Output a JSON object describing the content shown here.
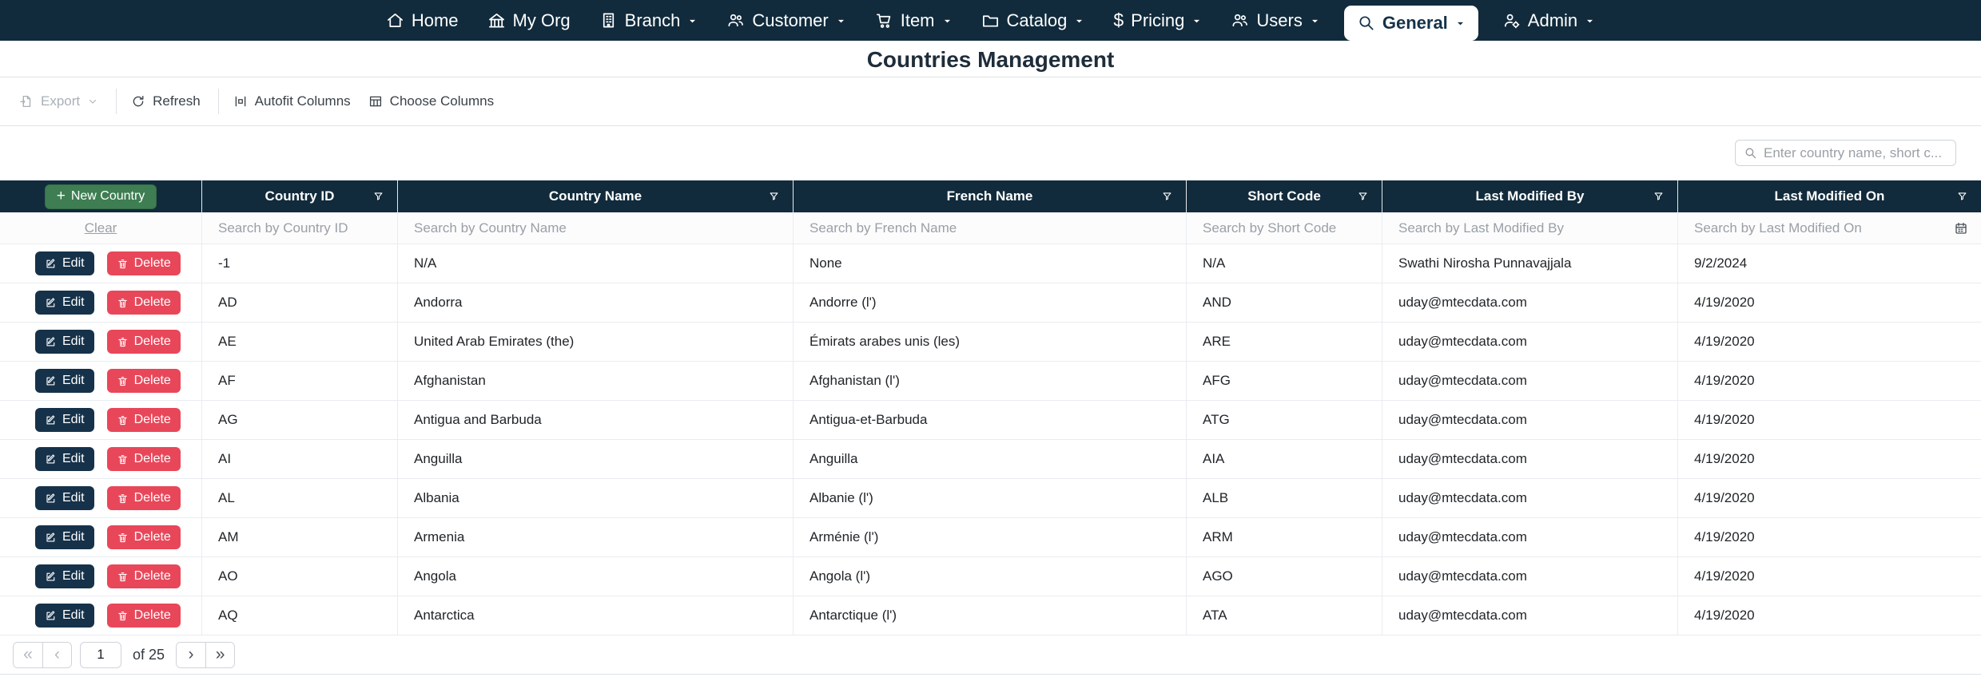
{
  "navbar": {
    "items": [
      {
        "label": "Home",
        "icon": "home-icon",
        "caret": false,
        "active": false
      },
      {
        "label": "My Org",
        "icon": "bank-icon",
        "caret": false,
        "active": false
      },
      {
        "label": "Branch",
        "icon": "building-icon",
        "caret": true,
        "active": false
      },
      {
        "label": "Customer",
        "icon": "people-icon",
        "caret": true,
        "active": false
      },
      {
        "label": "Item",
        "icon": "cart-icon",
        "caret": true,
        "active": false
      },
      {
        "label": "Catalog",
        "icon": "folder-icon",
        "caret": true,
        "active": false
      },
      {
        "label": "Pricing",
        "icon": "dollar-icon",
        "caret": true,
        "active": false
      },
      {
        "label": "Users",
        "icon": "people-icon",
        "caret": true,
        "active": false
      },
      {
        "label": "General",
        "icon": "search-icon",
        "caret": true,
        "active": true
      },
      {
        "label": "Admin",
        "icon": "person-gear-icon",
        "caret": true,
        "active": false
      }
    ]
  },
  "page": {
    "title": "Countries Management"
  },
  "toolbar": {
    "items": [
      {
        "label": "Export",
        "icon": "export-icon",
        "caret": true,
        "disabled": true,
        "divider_after": true
      },
      {
        "label": "Refresh",
        "icon": "refresh-icon",
        "caret": false,
        "disabled": false,
        "divider_after": true
      },
      {
        "label": "Autofit Columns",
        "icon": "autofit-icon",
        "caret": false,
        "disabled": false,
        "divider_after": false
      },
      {
        "label": "Choose Columns",
        "icon": "table-icon",
        "caret": false,
        "disabled": false,
        "divider_after": false
      }
    ]
  },
  "search": {
    "placeholder": "Enter country name, short c..."
  },
  "grid": {
    "columns": [
      {
        "label": "Country ID"
      },
      {
        "label": "Country Name"
      },
      {
        "label": "French Name"
      },
      {
        "label": "Short Code"
      },
      {
        "label": "Last Modified By"
      },
      {
        "label": "Last Modified On"
      }
    ],
    "filters": {
      "clear_label": "Clear",
      "placeholders": [
        "Search by Country ID",
        "Search by Country Name",
        "Search by French Name",
        "Search by Short Code",
        "Search by Last Modified By",
        "Search by Last Modified On"
      ],
      "calendar_on_last": true
    },
    "actions": {
      "new_label": "New Country",
      "edit_label": "Edit",
      "delete_label": "Delete"
    },
    "rows": [
      [
        "-1",
        "N/A",
        "None",
        "N/A",
        "Swathi Nirosha Punnavajjala",
        "9/2/2024"
      ],
      [
        "AD",
        "Andorra",
        "Andorre (l')",
        "AND",
        "uday@mtecdata.com",
        "4/19/2020"
      ],
      [
        "AE",
        "United Arab Emirates (the)",
        "Émirats arabes unis (les)",
        "ARE",
        "uday@mtecdata.com",
        "4/19/2020"
      ],
      [
        "AF",
        "Afghanistan",
        "Afghanistan (l')",
        "AFG",
        "uday@mtecdata.com",
        "4/19/2020"
      ],
      [
        "AG",
        "Antigua and Barbuda",
        "Antigua-et-Barbuda",
        "ATG",
        "uday@mtecdata.com",
        "4/19/2020"
      ],
      [
        "AI",
        "Anguilla",
        "Anguilla",
        "AIA",
        "uday@mtecdata.com",
        "4/19/2020"
      ],
      [
        "AL",
        "Albania",
        "Albanie (l')",
        "ALB",
        "uday@mtecdata.com",
        "4/19/2020"
      ],
      [
        "AM",
        "Armenia",
        "Arménie (l')",
        "ARM",
        "uday@mtecdata.com",
        "4/19/2020"
      ],
      [
        "AO",
        "Angola",
        "Angola (l')",
        "AGO",
        "uday@mtecdata.com",
        "4/19/2020"
      ],
      [
        "AQ",
        "Antarctica",
        "Antarctique (l')",
        "ATA",
        "uday@mtecdata.com",
        "4/19/2020"
      ]
    ]
  },
  "pagination": {
    "first_glyph": "«",
    "prev_glyph": "‹",
    "page_value": "1",
    "total_label": "of 25",
    "next_glyph": "›",
    "last_glyph": "»"
  },
  "colors": {
    "navbar_bg": "#112b3c",
    "accent_green": "#3e7e52",
    "danger_red": "#e8475a",
    "edit_navy": "#16324a"
  }
}
